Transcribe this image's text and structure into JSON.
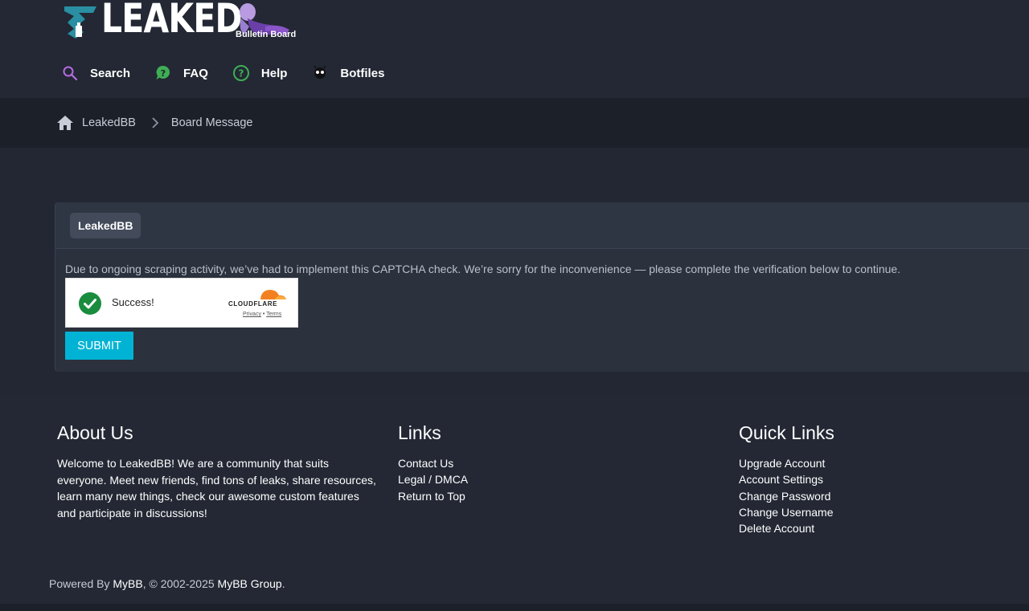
{
  "header": {
    "logo_text": "LEAKED",
    "logo_subtitle": "Bulletin Board",
    "nav": [
      {
        "label": "Search",
        "icon": "search-icon"
      },
      {
        "label": "FAQ",
        "icon": "faq-icon"
      },
      {
        "label": "Help",
        "icon": "help-icon"
      },
      {
        "label": "Botfiles",
        "icon": "bot-icon"
      }
    ]
  },
  "breadcrumb": {
    "home": "LeakedBB",
    "current": "Board Message"
  },
  "panel": {
    "title": "LeakedBB",
    "message": "Due to ongoing scraping activity, we’ve had to implement this CAPTCHA check. We’re sorry for the inconvenience — please complete the verification below to continue.",
    "captcha": {
      "status": "Success!",
      "brand": "CLOUDFLARE",
      "privacy": "Privacy",
      "separator": "•",
      "terms": "Terms"
    },
    "submit_label": "SUBMIT"
  },
  "footer": {
    "about": {
      "title": "About Us",
      "text": "Welcome to LeakedBB! We are a community that suits everyone. Meet new friends, find tons of leaks, share resources, learn many new things, check our awesome custom features and participate in discussions!"
    },
    "links": {
      "title": "Links",
      "items": [
        "Contact Us",
        "Legal / DMCA",
        "Return to Top"
      ]
    },
    "quick_links": {
      "title": "Quick Links",
      "items": [
        "Upgrade Account",
        "Account Settings",
        "Change Password",
        "Change Username",
        "Delete Account"
      ]
    },
    "powered": {
      "prefix": "Powered By ",
      "mybb": "MyBB",
      "middle": ", © 2002-2025 ",
      "group": "MyBB Group",
      "suffix": "."
    }
  },
  "colors": {
    "background": "#222733",
    "submit": "#00b3d4",
    "success": "#1a8c3e",
    "cloudflare": "#f38020"
  }
}
